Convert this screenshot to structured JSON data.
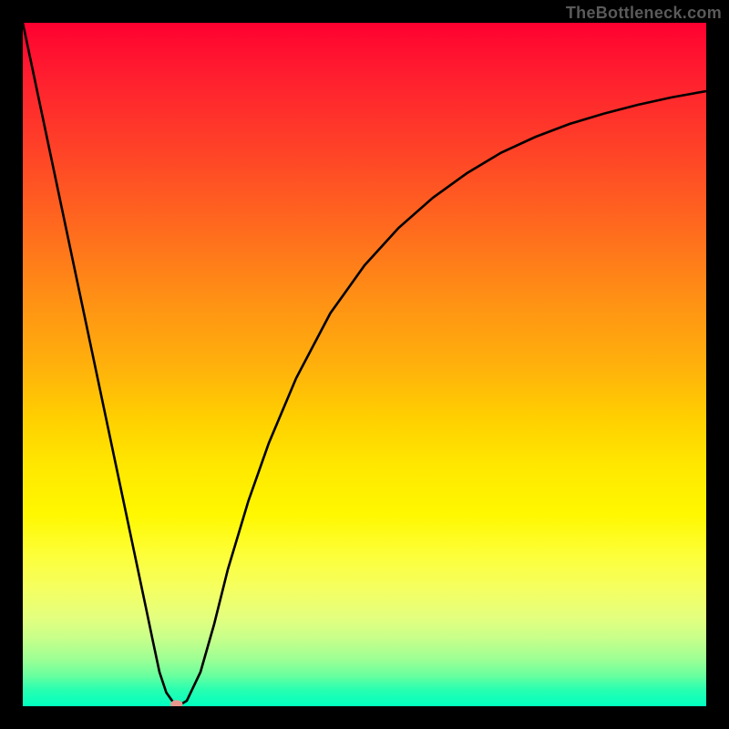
{
  "watermark": "TheBottleneck.com",
  "chart_data": {
    "type": "line",
    "title": "",
    "xlabel": "",
    "ylabel": "",
    "xlim": [
      0,
      100
    ],
    "ylim": [
      0,
      100
    ],
    "grid": false,
    "legend": false,
    "background": "radial-gradient red to green (top to bottom)",
    "series": [
      {
        "name": "bottleneck-curve",
        "color": "#000000",
        "x": [
          0,
          2,
          4,
          6,
          8,
          10,
          12,
          14,
          16,
          18,
          19,
          20,
          21,
          22,
          23,
          24,
          26,
          28,
          30,
          33,
          36,
          40,
          45,
          50,
          55,
          60,
          65,
          70,
          75,
          80,
          85,
          90,
          95,
          100
        ],
        "y": [
          100,
          90.5,
          81,
          71.5,
          62,
          52.5,
          43,
          33.5,
          24,
          14.5,
          9.7,
          5,
          2,
          0.6,
          0.2,
          0.8,
          5,
          12,
          20,
          30,
          38.5,
          48,
          57.5,
          64.5,
          70,
          74.4,
          78,
          81,
          83.3,
          85.2,
          86.7,
          88,
          89.1,
          90
        ]
      }
    ],
    "markers": [
      {
        "name": "min-point",
        "x": 22.5,
        "y": 0.3,
        "color": "#e8978f",
        "shape": "ellipse"
      }
    ]
  }
}
